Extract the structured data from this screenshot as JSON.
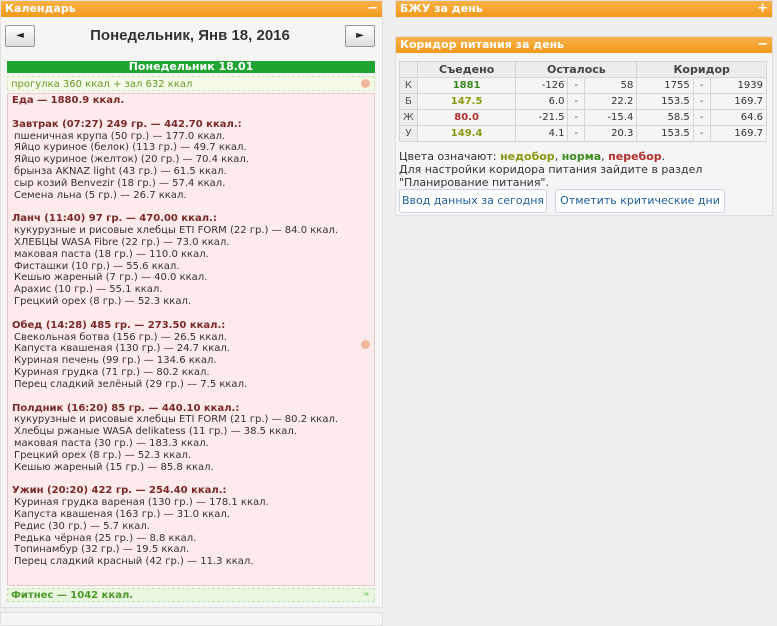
{
  "calendar": {
    "header": "Календарь",
    "toggle": "−",
    "prev": "◄",
    "next": "►",
    "date_title": "Понедельник, Янв 18, 2016",
    "day_bar": "Понедельник 18.01",
    "activity": "прогулка 360 ккал + зал 632 ккал",
    "food_total": "Еда — 1880.9 ккал.",
    "meals": [
      {
        "title": "Завтрак (07:27) 249 гр. — 442.70 ккал.:",
        "items": [
          "пшеничная крупа (50 гр.) — 177.0 ккал.",
          "Яйцо куриное (белок) (113 гр.) — 49.7 ккал.",
          "Яйцо куриное (желток) (20 гр.) — 70.4 ккал.",
          "брынза AKNAZ light (43 гр.) — 61.5 ккал.",
          "сыр козий Benvezir (18 гр.) — 57.4 ккал.",
          "Семена льна (5 гр.) — 26.7 ккал."
        ]
      },
      {
        "title": "Ланч (11:40) 97 гр. — 470.00 ккал.:",
        "items": [
          "кукурузные и рисовые хлебцы ETI FORM (22 гр.) — 84.0 ккал.",
          "ХЛЕБЦЫ WASA Fibre (22 гр.) — 73.0 ккал.",
          "маковая паста (18 гр.) — 110.0 ккал.",
          "Фисташки (10 гр.) — 55.6 ккал.",
          "Кешью жареный (7 гр.) — 40.0 ккал.",
          "Арахис (10 гр.) — 55.1 ккал.",
          "Грецкий орех (8 гр.) — 52.3 ккал."
        ]
      },
      {
        "title": "Обед (14:28) 485 гр. — 273.50 ккал.:",
        "items": [
          "Свекольная ботва (156 гр.) — 26.5 ккал.",
          "Капуста квашеная (130 гр.) — 24.7 ккал.",
          "Куриная печень (99 гр.) — 134.6 ккал.",
          "Куриная грудка (71 гр.) — 80.2 ккал.",
          "Перец сладкий зелёный (29 гр.) — 7.5 ккал."
        ]
      },
      {
        "title": "Полдник (16:20) 85 гр. — 440.10 ккал.:",
        "items": [
          "кукурузные и рисовые хлебцы ETI FORM (21 гр.) — 80.2 ккал.",
          "Хлебцы ржаные WASA delikatess (11 гр.) — 38.5 ккал.",
          "маковая паста (30 гр.) — 183.3 ккал.",
          "Грецкий орех (8 гр.) — 52.3 ккал.",
          "Кешью жареный (15 гр.) — 85.8 ккал."
        ]
      },
      {
        "title": "Ужин (20:20) 422 гр. — 254.40 ккал.:",
        "items": [
          "Куриная грудка вареная (130 гр.) — 178.1 ккал.",
          "Капуста квашеная (163 гр.) — 31.0 ккал.",
          "Редис (30 гр.) — 5.7 ккал.",
          "Редька чёрная (25 гр.) — 8.8 ккал.",
          "Топинамбур (32 гр.) — 19.5 ккал.",
          "Перец сладкий красный (42 гр.) — 11.3 ккал."
        ]
      }
    ],
    "fitness": "Фитнес — 1042 ккал."
  },
  "bju": {
    "header": "БЖУ за день",
    "toggle": "+"
  },
  "corridor": {
    "header": "Коридор питания за день",
    "toggle": "−",
    "columns": [
      "Съедено",
      "Осталось",
      "Коридор"
    ],
    "rows": [
      {
        "label": "К",
        "eaten": "1881",
        "color": "#3a8a1e",
        "rem_lo": "-126",
        "rem_hi": "58",
        "cor_lo": "1755",
        "cor_hi": "1939"
      },
      {
        "label": "Б",
        "eaten": "147.5",
        "color": "#8a9a10",
        "rem_lo": "6.0",
        "rem_hi": "22.2",
        "cor_lo": "153.5",
        "cor_hi": "169.7"
      },
      {
        "label": "Ж",
        "eaten": "80.0",
        "color": "#b03030",
        "rem_lo": "-21.5",
        "rem_hi": "-15.4",
        "cor_lo": "58.5",
        "cor_hi": "64.6"
      },
      {
        "label": "У",
        "eaten": "149.4",
        "color": "#8a9a10",
        "rem_lo": "4.1",
        "rem_hi": "20.3",
        "cor_lo": "153.5",
        "cor_hi": "169.7"
      }
    ],
    "dash": "-",
    "legend_prefix": "Цвета означают:",
    "legend_under": "недобор",
    "legend_norm": "норма",
    "legend_over": "перебор",
    "legend_under_color": "#8a9a10",
    "legend_norm_color": "#3a8a1e",
    "legend_over_color": "#b03030",
    "note": "Для настройки коридора питания зайдите в раздел \"Планирование питания\".",
    "btn_input": "Ввод данных за сегодня",
    "btn_critical": "Отметить критические дни"
  }
}
